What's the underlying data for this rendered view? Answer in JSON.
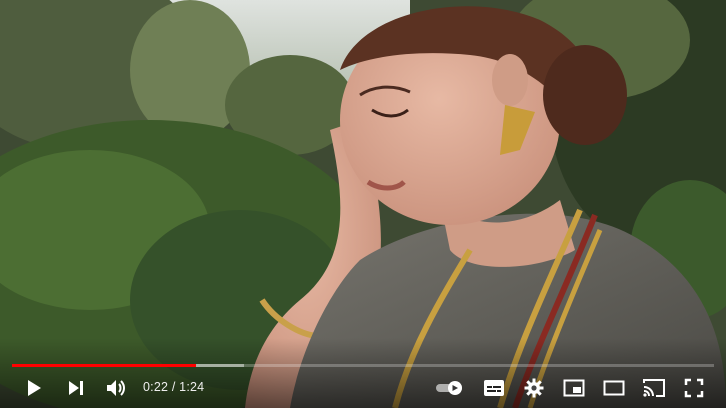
{
  "video": {
    "current_time": "0:22",
    "separator": " / ",
    "duration": "1:24",
    "progress_fraction": 0.2619,
    "buffered_fraction": 0.33
  },
  "colors": {
    "progress_played": "#ff0000",
    "controls": "#ffffff"
  },
  "controls": {
    "left": [
      "play-icon",
      "next-icon",
      "volume-icon"
    ],
    "right": [
      "autoplay-toggle-icon",
      "subtitles-icon",
      "settings-gear-icon",
      "miniplayer-icon",
      "theater-mode-icon",
      "cast-icon",
      "fullscreen-icon"
    ]
  }
}
